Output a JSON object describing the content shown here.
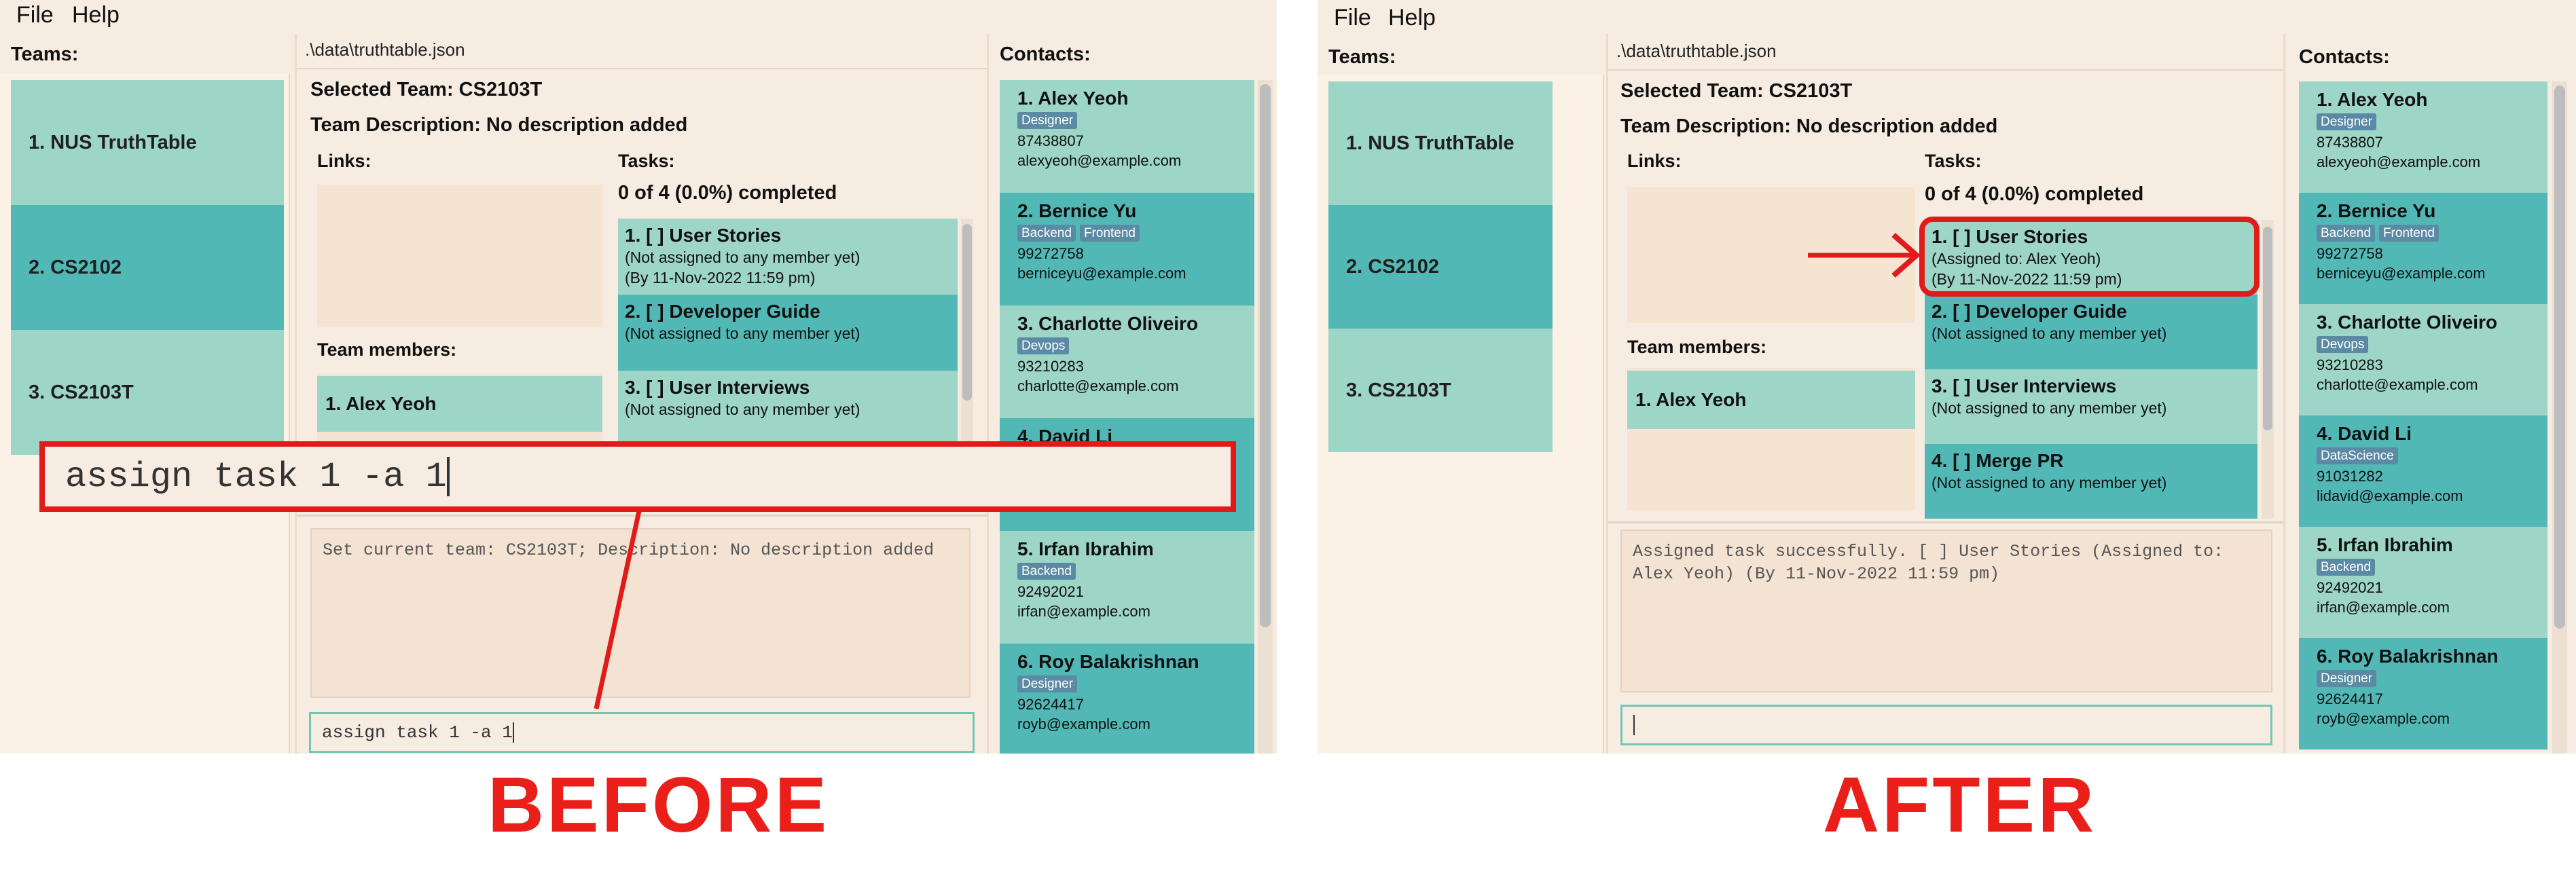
{
  "menu": {
    "file": "File",
    "help": "Help"
  },
  "panels": {
    "teams_title": "Teams:",
    "contacts_title": "Contacts:",
    "links_label": "Links:",
    "tasks_label": "Tasks:",
    "members_label": "Team members:"
  },
  "teams": [
    "1. NUS TruthTable",
    "2. CS2102",
    "3. CS2103T"
  ],
  "file_path": ".\\data\\truthtable.json",
  "selected_team": "Selected Team: CS2103T",
  "team_description": "Team Description: No description added",
  "task_progress": "0 of 4 (0.0%) completed",
  "members": [
    "1. Alex Yeoh"
  ],
  "contacts": [
    {
      "name": "1. Alex Yeoh",
      "tags": [
        "Designer"
      ],
      "phone": "87438807",
      "email": "alexyeoh@example.com"
    },
    {
      "name": "2. Bernice Yu",
      "tags": [
        "Backend",
        "Frontend"
      ],
      "phone": "99272758",
      "email": "berniceyu@example.com"
    },
    {
      "name": "3. Charlotte Oliveiro",
      "tags": [
        "Devops"
      ],
      "phone": "93210283",
      "email": "charlotte@example.com"
    },
    {
      "name": "4. David Li",
      "tags": [
        "DataScience"
      ],
      "phone": "91031282",
      "email": "lidavid@example.com"
    },
    {
      "name": "5. Irfan Ibrahim",
      "tags": [
        "Backend"
      ],
      "phone": "92492021",
      "email": "irfan@example.com"
    },
    {
      "name": "6. Roy Balakrishnan",
      "tags": [
        "Designer"
      ],
      "phone": "92624417",
      "email": "royb@example.com"
    }
  ],
  "before": {
    "tasks": [
      {
        "title": "1. [ ] User Stories",
        "assignee": "(Not assigned to any member yet)",
        "deadline": "(By 11-Nov-2022 11:59 pm)"
      },
      {
        "title": "2. [ ] Developer Guide",
        "assignee": "(Not assigned to any member yet)",
        "deadline": ""
      },
      {
        "title": "3. [ ] User Interviews",
        "assignee": "(Not assigned to any member yet)",
        "deadline": ""
      }
    ],
    "result": "Set current team: CS2103T; Description: No description added",
    "command_input": "assign task 1 -a 1",
    "callout_command": "assign task 1 -a 1",
    "label": "BEFORE"
  },
  "after": {
    "tasks": [
      {
        "title": "1. [ ] User Stories",
        "assignee": "(Assigned to: Alex Yeoh)",
        "deadline": "(By 11-Nov-2022 11:59 pm)"
      },
      {
        "title": "2. [ ] Developer Guide",
        "assignee": "(Not assigned to any member yet)",
        "deadline": ""
      },
      {
        "title": "3. [ ] User Interviews",
        "assignee": "(Not assigned to any member yet)",
        "deadline": ""
      },
      {
        "title": "4. [ ] Merge PR",
        "assignee": "(Not assigned to any member yet)",
        "deadline": ""
      }
    ],
    "result": "Assigned task successfully. [ ] User Stories (Assigned to: Alex Yeoh) (By 11-Nov-2022 11:59 pm)",
    "command_input": "",
    "label": "AFTER"
  },
  "colors": {
    "card_light": "#9dd5c7",
    "card_dark": "#52b8b6",
    "tag": "#5a8aa4",
    "annotation_red": "#e11a1a",
    "background": "#f7ece1"
  }
}
